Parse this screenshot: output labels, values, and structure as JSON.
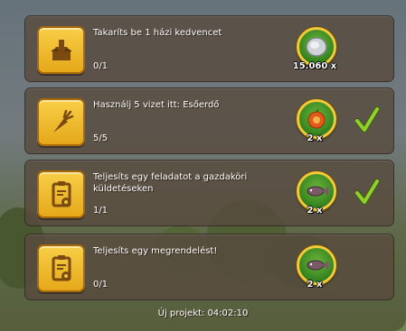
{
  "tasks": [
    {
      "title": "Takaríts be 1 házi kedvencet",
      "progress": "0/1",
      "icon": "box-download-icon",
      "reward_icon": "silver-coin-icon",
      "reward_amount": "15.060 x",
      "completed": false
    },
    {
      "title": "Használj 5 vizet itt: Esőerdő",
      "progress": "5/5",
      "icon": "carrot-icon",
      "reward_icon": "fruit-orange-icon",
      "reward_amount": "2 x",
      "completed": true
    },
    {
      "title": "Teljesíts egy feladatot a gazdaköri küldetéseken",
      "progress": "1/1",
      "icon": "clipboard-badge-icon",
      "reward_icon": "fish-icon",
      "reward_amount": "2 x",
      "completed": true
    },
    {
      "title": "Teljesíts egy megrendelést!",
      "progress": "0/1",
      "icon": "clipboard-badge-icon",
      "reward_icon": "fish-icon",
      "reward_amount": "2 x",
      "completed": false
    }
  ],
  "footer": {
    "new_project": "Új projekt: 04:02:10"
  },
  "colors": {
    "icon_box": "#e6a81a",
    "reward_ring": "#f1c93a",
    "check": "#8fd12a"
  }
}
